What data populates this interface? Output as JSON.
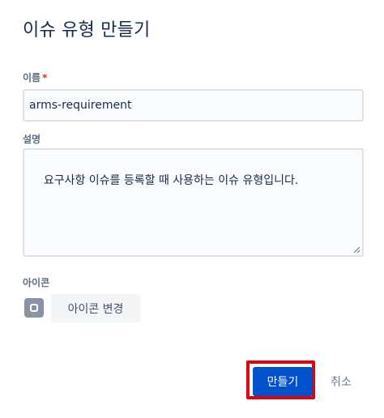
{
  "dialog": {
    "title": "이슈 유형 만들기"
  },
  "form": {
    "name_label": "이름",
    "required_mark": "*",
    "name_value": "arms-requirement",
    "description_label": "설명",
    "description_value": "요구사항 이슈를 등록할 때 사용하는 이슈 유형입니다.",
    "icon_label": "아이콘",
    "change_icon_label": "아이콘 변경"
  },
  "footer": {
    "create_label": "만들기",
    "cancel_label": "취소"
  },
  "colors": {
    "primary": "#0052cc",
    "highlight": "#e3000f",
    "required": "#de350b"
  },
  "icons": {
    "issue_type_icon": "square-ring-icon"
  }
}
